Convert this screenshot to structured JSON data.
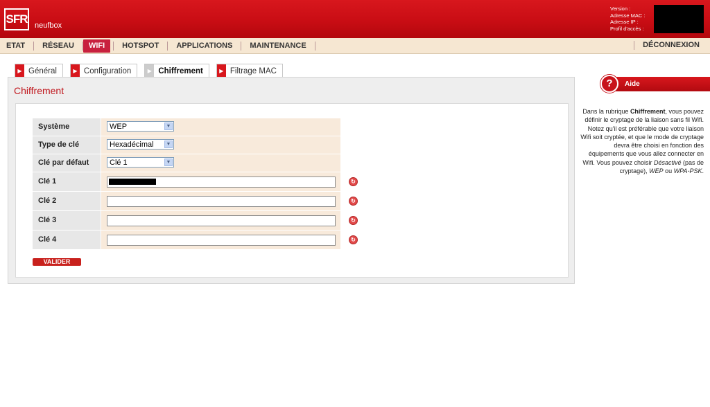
{
  "header": {
    "logo": "SFR",
    "brand": "neufbox",
    "info_labels": [
      "Version",
      "Adresse MAC",
      "Adresse IP",
      "Profil d'accès"
    ]
  },
  "menu": {
    "items": [
      "ETAT",
      "RÉSEAU",
      "WIFI",
      "HOTSPOT",
      "APPLICATIONS",
      "MAINTENANCE"
    ],
    "active": "WIFI",
    "logout": "DÉCONNEXION"
  },
  "tabs": [
    {
      "label": "Général",
      "active": false
    },
    {
      "label": "Configuration",
      "active": false
    },
    {
      "label": "Chiffrement",
      "active": true
    },
    {
      "label": "Filtrage MAC",
      "active": false
    }
  ],
  "panel": {
    "title": "Chiffrement",
    "systeme": {
      "label": "Système",
      "value": "WEP"
    },
    "type_cle": {
      "label": "Type de clé",
      "value": "Hexadécimal"
    },
    "cle_defaut": {
      "label": "Clé par défaut",
      "value": "Clé 1"
    },
    "keys": [
      {
        "label": "Clé 1",
        "value": "",
        "masked": true
      },
      {
        "label": "Clé 2",
        "value": ""
      },
      {
        "label": "Clé 3",
        "value": ""
      },
      {
        "label": "Clé 4",
        "value": ""
      }
    ],
    "submit": "VALIDER"
  },
  "help": {
    "title": "Aide",
    "text_parts": {
      "p1": "Dans la rubrique ",
      "b1": "Chiffrement",
      "p2": ", vous pouvez définir le cryptage de la liaison sans fil Wifi. Notez qu'il est préférable que votre liaison Wifi soit cryptée, et que le mode de cryptage devra être choisi en fonction des équipements que vous allez connecter en Wifi. Vous pouvez choisir ",
      "i1": "Désactivé",
      "p3": " (pas de cryptage), ",
      "i2": "WEP",
      "p4": " ou ",
      "i3": "WPA-PSK",
      "p5": "."
    }
  },
  "colors": {
    "brand_red": "#c90d14",
    "menu_bg": "#f6e7d2",
    "active_menu": "#c8213e",
    "title_red": "#c0171d"
  },
  "icons": {
    "tab_arrow": "arrow-right-icon",
    "dropdown": "chevron-down-icon",
    "key": "key-generate-icon",
    "help": "help-icon"
  }
}
